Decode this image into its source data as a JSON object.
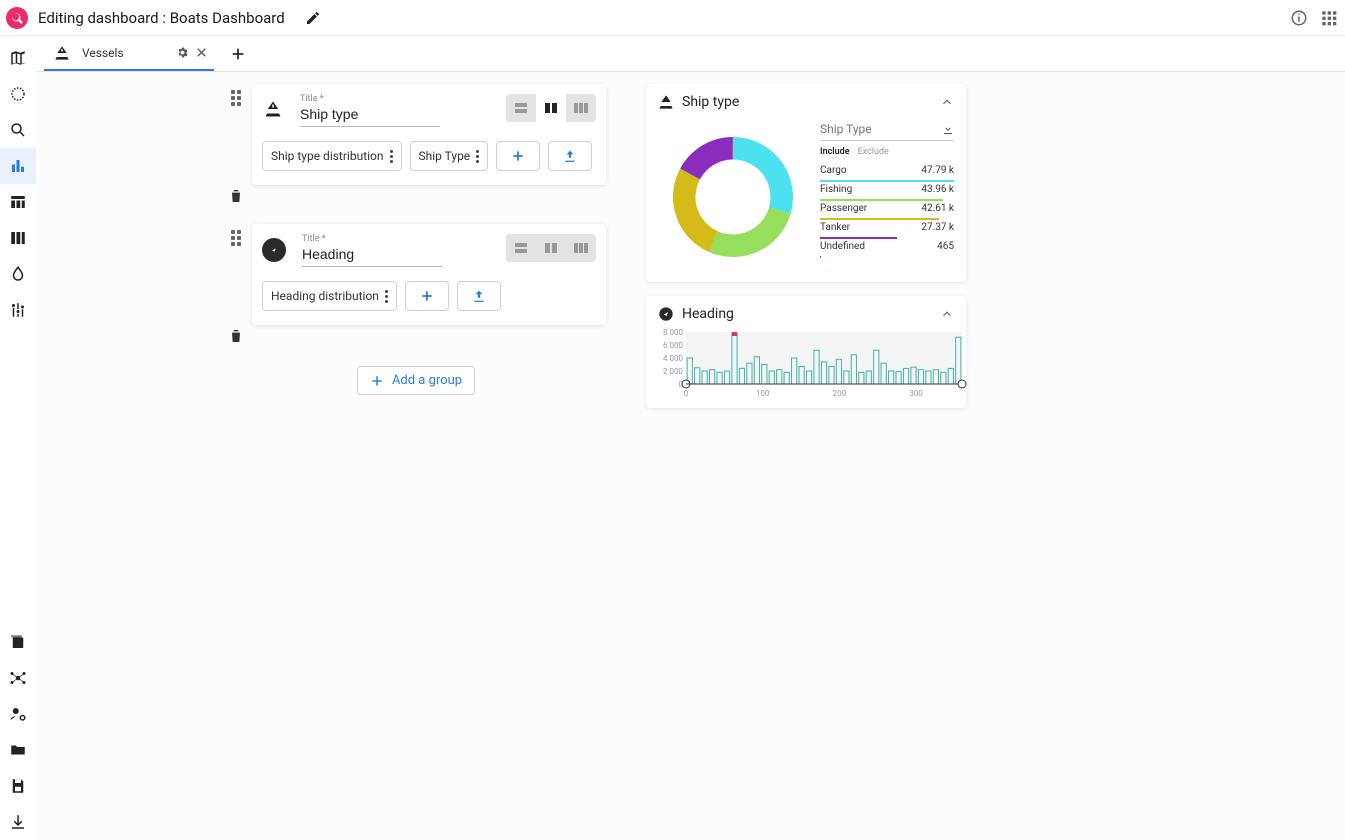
{
  "header": {
    "title": "Editing dashboard : Boats Dashboard"
  },
  "tabs": {
    "active": {
      "label": "Vessels"
    }
  },
  "cards": [
    {
      "title_label": "Title *",
      "title_value": "Ship type",
      "chips": [
        "Ship type distribution",
        "Ship Type"
      ],
      "icon": "boat"
    },
    {
      "title_label": "Title *",
      "title_value": "Heading",
      "chips": [
        "Heading distribution"
      ],
      "icon": "compass"
    }
  ],
  "add_group_label": "Add a group",
  "preview": {
    "ship_panel_title": "Ship type",
    "ship_legend_title": "Ship Type",
    "legend_tab_include": "Include",
    "legend_tab_exclude": "Exclude",
    "heading_panel_title": "Heading"
  },
  "chart_data": [
    {
      "type": "pie",
      "title": "Ship Type",
      "series": [
        {
          "name": "Cargo",
          "value": 47790,
          "display": "47.79 k",
          "color": "#4be1ee"
        },
        {
          "name": "Fishing",
          "value": 43960,
          "display": "43.96 k",
          "color": "#96de5b"
        },
        {
          "name": "Passenger",
          "value": 42610,
          "display": "42.61 k",
          "color": "#d5bb19"
        },
        {
          "name": "Tanker",
          "value": 27370,
          "display": "27.37 k",
          "color": "#8a2dbe"
        },
        {
          "name": "Undefined",
          "value": 465,
          "display": "465",
          "color": "#ec2b69"
        }
      ]
    },
    {
      "type": "bar",
      "title": "Heading",
      "xlabel": "",
      "ylabel": "",
      "xlim": [
        0,
        360
      ],
      "ylim": [
        0,
        8000
      ],
      "yticks": [
        0,
        2000,
        4000,
        6000,
        8000
      ],
      "ytick_labels": [
        "0",
        "2 000",
        "4 000",
        "6 000",
        "8 000"
      ],
      "xticks": [
        0,
        100,
        200,
        300
      ],
      "categories": [
        0,
        10,
        20,
        30,
        40,
        50,
        60,
        70,
        80,
        90,
        100,
        110,
        120,
        130,
        140,
        150,
        160,
        170,
        180,
        190,
        200,
        210,
        220,
        230,
        240,
        250,
        260,
        270,
        280,
        290,
        300,
        310,
        320,
        330,
        340,
        350,
        360
      ],
      "values": [
        4000,
        2500,
        2000,
        2200,
        1800,
        2000,
        7800,
        2400,
        3200,
        4200,
        3000,
        2000,
        2200,
        1800,
        4000,
        2700,
        2000,
        5200,
        3400,
        2700,
        3800,
        2000,
        4500,
        1800,
        2000,
        5200,
        3200,
        2000,
        1900,
        2400,
        2600,
        2200,
        2000,
        2200,
        1800,
        2400,
        7200
      ]
    }
  ]
}
